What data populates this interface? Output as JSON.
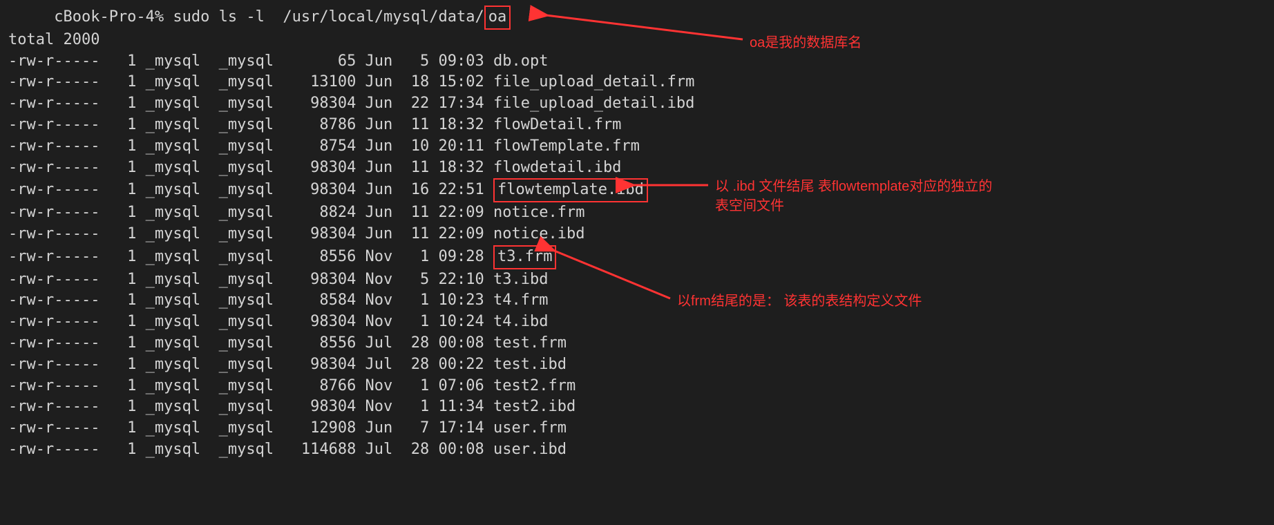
{
  "prompt": {
    "host_prefix": "     cBook-Pro-4% ",
    "command_part1": "sudo ls -l  /usr/local/mysql/data/",
    "command_highlighted": "oa"
  },
  "total_line": "total 2000",
  "file_rows": [
    {
      "perm": "-rw-r-----",
      "links": "1",
      "owner": "_mysql",
      "group": "_mysql",
      "size": "65",
      "date": "Jun   5 09:03",
      "name": "db.opt",
      "highlight": false
    },
    {
      "perm": "-rw-r-----",
      "links": "1",
      "owner": "_mysql",
      "group": "_mysql",
      "size": "13100",
      "date": "Jun  18 15:02",
      "name": "file_upload_detail.frm",
      "highlight": false
    },
    {
      "perm": "-rw-r-----",
      "links": "1",
      "owner": "_mysql",
      "group": "_mysql",
      "size": "98304",
      "date": "Jun  22 17:34",
      "name": "file_upload_detail.ibd",
      "highlight": false
    },
    {
      "perm": "-rw-r-----",
      "links": "1",
      "owner": "_mysql",
      "group": "_mysql",
      "size": "8786",
      "date": "Jun  11 18:32",
      "name": "flowDetail.frm",
      "highlight": false
    },
    {
      "perm": "-rw-r-----",
      "links": "1",
      "owner": "_mysql",
      "group": "_mysql",
      "size": "8754",
      "date": "Jun  10 20:11",
      "name": "flowTemplate.frm",
      "highlight": false
    },
    {
      "perm": "-rw-r-----",
      "links": "1",
      "owner": "_mysql",
      "group": "_mysql",
      "size": "98304",
      "date": "Jun  11 18:32",
      "name": "flowdetail.ibd",
      "highlight": false
    },
    {
      "perm": "-rw-r-----",
      "links": "1",
      "owner": "_mysql",
      "group": "_mysql",
      "size": "98304",
      "date": "Jun  16 22:51",
      "name": "flowtemplate.ibd",
      "highlight": true
    },
    {
      "perm": "-rw-r-----",
      "links": "1",
      "owner": "_mysql",
      "group": "_mysql",
      "size": "8824",
      "date": "Jun  11 22:09",
      "name": "notice.frm",
      "highlight": false
    },
    {
      "perm": "-rw-r-----",
      "links": "1",
      "owner": "_mysql",
      "group": "_mysql",
      "size": "98304",
      "date": "Jun  11 22:09",
      "name": "notice.ibd",
      "highlight": false
    },
    {
      "perm": "-rw-r-----",
      "links": "1",
      "owner": "_mysql",
      "group": "_mysql",
      "size": "8556",
      "date": "Nov   1 09:28",
      "name": "t3.frm",
      "highlight": true
    },
    {
      "perm": "-rw-r-----",
      "links": "1",
      "owner": "_mysql",
      "group": "_mysql",
      "size": "98304",
      "date": "Nov   5 22:10",
      "name": "t3.ibd",
      "highlight": false
    },
    {
      "perm": "-rw-r-----",
      "links": "1",
      "owner": "_mysql",
      "group": "_mysql",
      "size": "8584",
      "date": "Nov   1 10:23",
      "name": "t4.frm",
      "highlight": false
    },
    {
      "perm": "-rw-r-----",
      "links": "1",
      "owner": "_mysql",
      "group": "_mysql",
      "size": "98304",
      "date": "Nov   1 10:24",
      "name": "t4.ibd",
      "highlight": false
    },
    {
      "perm": "-rw-r-----",
      "links": "1",
      "owner": "_mysql",
      "group": "_mysql",
      "size": "8556",
      "date": "Jul  28 00:08",
      "name": "test.frm",
      "highlight": false
    },
    {
      "perm": "-rw-r-----",
      "links": "1",
      "owner": "_mysql",
      "group": "_mysql",
      "size": "98304",
      "date": "Jul  28 00:22",
      "name": "test.ibd",
      "highlight": false
    },
    {
      "perm": "-rw-r-----",
      "links": "1",
      "owner": "_mysql",
      "group": "_mysql",
      "size": "8766",
      "date": "Nov   1 07:06",
      "name": "test2.frm",
      "highlight": false
    },
    {
      "perm": "-rw-r-----",
      "links": "1",
      "owner": "_mysql",
      "group": "_mysql",
      "size": "98304",
      "date": "Nov   1 11:34",
      "name": "test2.ibd",
      "highlight": false
    },
    {
      "perm": "-rw-r-----",
      "links": "1",
      "owner": "_mysql",
      "group": "_mysql",
      "size": "12908",
      "date": "Jun   7 17:14",
      "name": "user.frm",
      "highlight": false
    },
    {
      "perm": "-rw-r-----",
      "links": "1",
      "owner": "_mysql",
      "group": "_mysql",
      "size": "114688",
      "date": "Jul  28 00:08",
      "name": "user.ibd",
      "highlight": false
    }
  ],
  "annotations": {
    "a1": "oa是我的数据库名",
    "a2_line1": "以 .ibd 文件结尾 表flowtemplate对应的独立的",
    "a2_line2": "表空间文件",
    "a3": "以frm结尾的是：  该表的表结构定义文件"
  }
}
